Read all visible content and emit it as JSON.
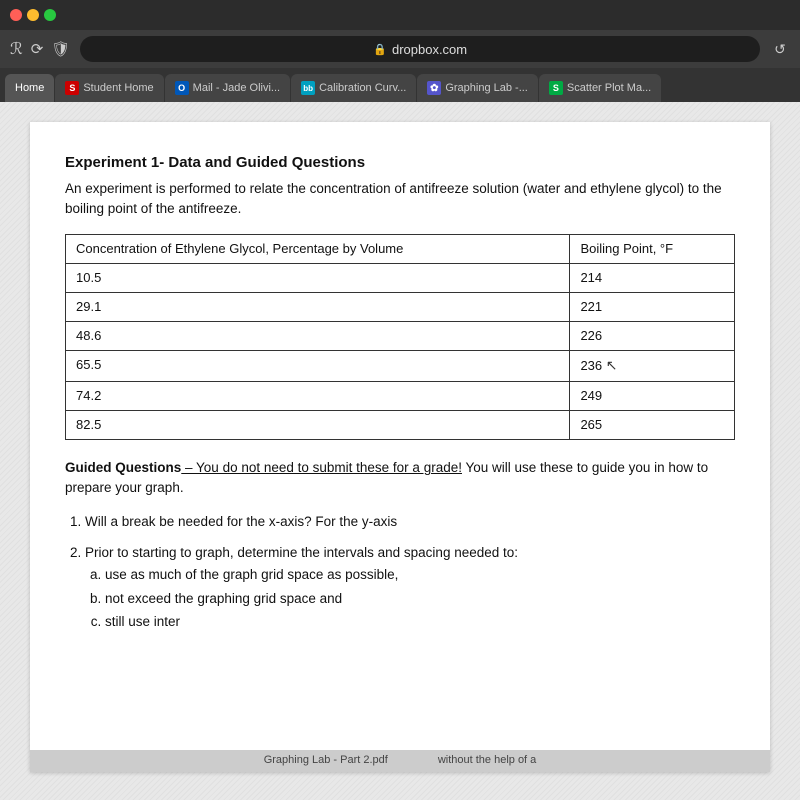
{
  "browser": {
    "address": "dropbox.com",
    "tabs": [
      {
        "id": "home",
        "label": "Home",
        "favicon_type": "home",
        "active": false
      },
      {
        "id": "student-home",
        "label": "Student Home",
        "favicon_type": "red",
        "favicon_char": "S",
        "active": false
      },
      {
        "id": "mail",
        "label": "Mail - Jade Olivi...",
        "favicon_type": "blue",
        "favicon_char": "O",
        "active": false
      },
      {
        "id": "calibration",
        "label": "Calibration Curv...",
        "favicon_type": "cyan",
        "favicon_char": "bb",
        "active": false
      },
      {
        "id": "graphing",
        "label": "Graphing Lab -...",
        "favicon_type": "purple",
        "favicon_char": "✿",
        "active": false
      },
      {
        "id": "scatter",
        "label": "Scatter Plot Ma...",
        "favicon_type": "green",
        "favicon_char": "S",
        "active": true
      }
    ]
  },
  "document": {
    "title": "Experiment 1- Data and Guided Questions",
    "intro": "An experiment is performed to relate the concentration of antifreeze solution (water and ethylene glycol) to the boiling point of the antifreeze.",
    "table": {
      "headers": [
        "Concentration of Ethylene Glycol, Percentage by Volume",
        "Boiling Point, °F"
      ],
      "rows": [
        [
          "10.5",
          "214"
        ],
        [
          "29.1",
          "221"
        ],
        [
          "48.6",
          "226"
        ],
        [
          "65.5",
          "236"
        ],
        [
          "74.2",
          "249"
        ],
        [
          "82.5",
          "265"
        ]
      ]
    },
    "guided_questions_label": "Guided Questions",
    "guided_questions_note": " – You do not need to submit these for a grade!",
    "guided_questions_text": " You will use these to guide you in how to prepare your graph.",
    "questions": [
      {
        "text": "Will a break be needed for the x-axis? For the y-axis",
        "sub_items": []
      },
      {
        "text": "Prior to starting to graph, determine the intervals and spacing needed to:",
        "sub_items": [
          "use as much of the graph grid space as possible,",
          "not exceed the graphing grid space and",
          "still use inter"
        ]
      }
    ],
    "bottom_bar_left": "Graphing Lab - Part 2.pdf",
    "bottom_bar_right": "without the help of a"
  }
}
